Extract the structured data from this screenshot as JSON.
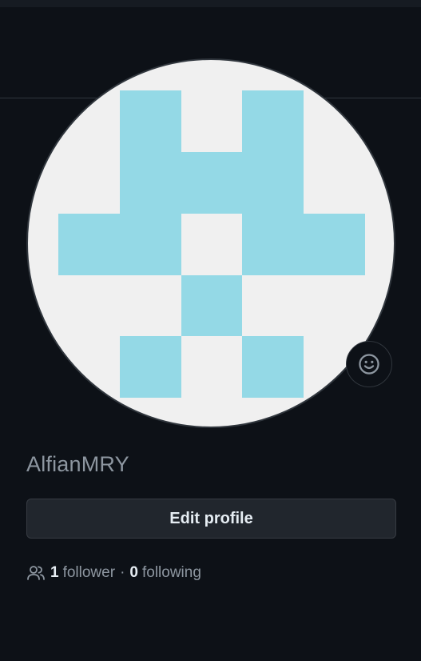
{
  "profile": {
    "username": "AlfianMRY",
    "edit_label": "Edit profile",
    "followers_count": "1",
    "followers_label": "follower",
    "separator": "·",
    "following_count": "0",
    "following_label": "following"
  },
  "icons": {
    "status": "smiley-icon",
    "followers": "people-icon"
  },
  "colors": {
    "background": "#0d1117",
    "avatar_background": "#f0f0f0",
    "identicon": "#94d9e6",
    "muted_text": "#8d96a0",
    "button_background": "#21262d",
    "border": "#30363d"
  }
}
